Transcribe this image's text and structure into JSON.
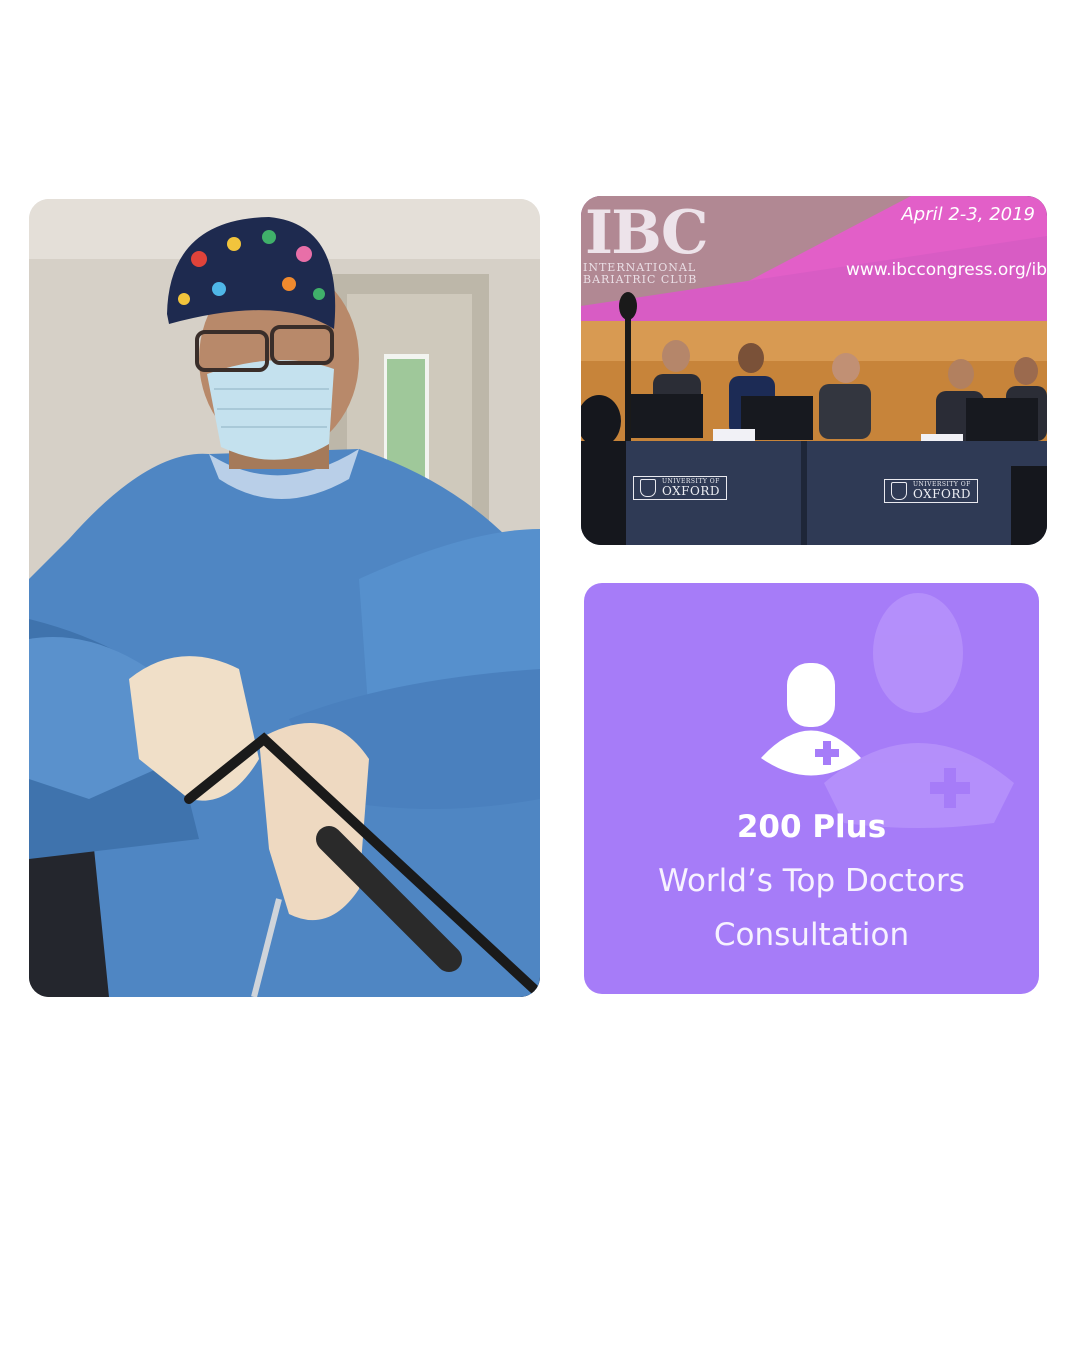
{
  "images": {
    "surgeon": {
      "alt": ""
    },
    "conference": {
      "banner_logo": "IBC",
      "banner_logo_subtitle_line1": "INTERNATIONAL",
      "banner_logo_subtitle_line2": "BARIATRIC CLUB",
      "banner_date": "April 2-3, 2019",
      "banner_url": "www.ibccongress.org/ib",
      "table_sign_small": "UNIVERSITY OF",
      "table_sign_big": "OXFORD"
    }
  },
  "stats_card": {
    "value": "200 Plus",
    "label_line1": "World’s Top Doctors",
    "label_line2": "Consultation",
    "icon": "doctor-user-plus-icon",
    "background_color": "#a67cf8",
    "icon_color": "#ffffff"
  }
}
